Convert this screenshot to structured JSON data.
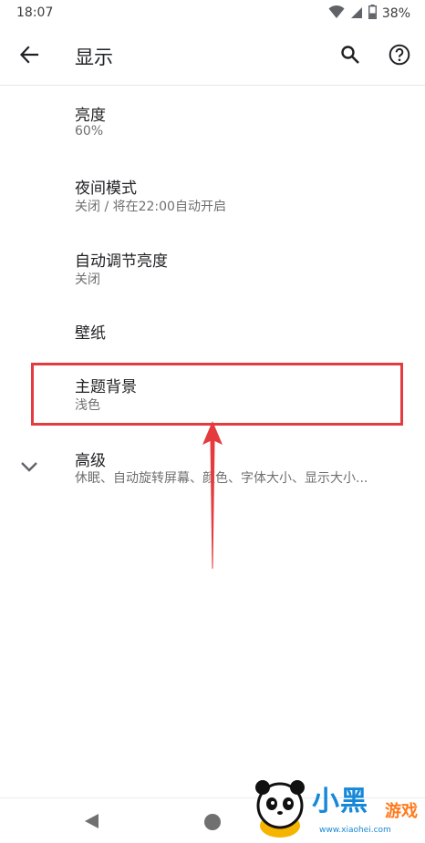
{
  "status_bar": {
    "time": "18:07",
    "battery": "38%",
    "icons": [
      "wifi-icon",
      "signal-icon",
      "battery-icon"
    ]
  },
  "app_bar": {
    "title": "显示",
    "icons": [
      "back-arrow-icon",
      "search-icon",
      "help-icon"
    ]
  },
  "preferences": [
    {
      "title": "亮度",
      "summary": "60%"
    },
    {
      "title": "夜间模式",
      "summary": "关闭 / 将在22:00自动开启"
    },
    {
      "title": "自动调节亮度",
      "summary": "关闭"
    },
    {
      "title": "壁纸",
      "summary": ""
    },
    {
      "title": "主题背景",
      "summary": "浅色"
    },
    {
      "title": "高级",
      "summary": "休眠、自动旋转屏幕、颜色、字体大小、显示大小..."
    }
  ],
  "annotation": {
    "color": "#e43b3e",
    "highlighted_item": "主题背景"
  },
  "nav_bar": {
    "icons": [
      "nav-back-icon",
      "nav-home-icon"
    ]
  },
  "watermark": {
    "brand": "小黑",
    "sub": "游戏",
    "url": "www.xiaohei.com"
  }
}
